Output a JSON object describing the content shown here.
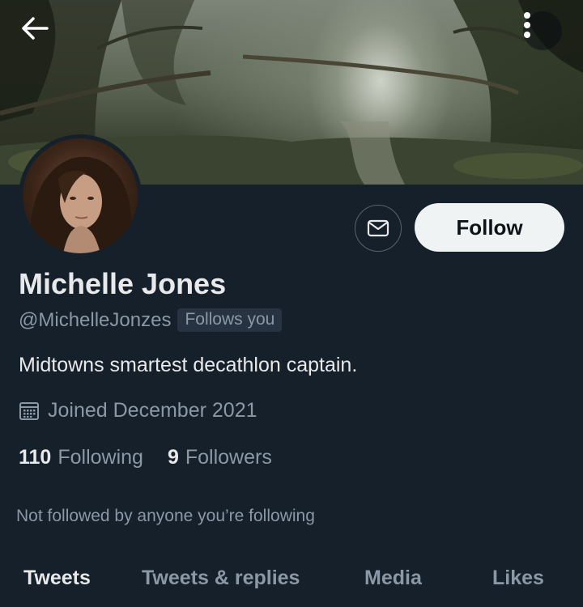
{
  "header": {
    "back_icon": "arrow-left-icon",
    "more_icon": "more-vertical-icon"
  },
  "profile": {
    "name": "Michelle Jones",
    "handle": "@MichelleJonzes",
    "follows_you": "Follows you",
    "bio": "Midtowns smartest decathlon captain.",
    "joined": "Joined December 2021",
    "calendar_icon": "calendar-icon",
    "message_icon": "envelope-icon",
    "follow_label": "Follow",
    "following_count": "110",
    "following_label": "Following",
    "followers_count": "9",
    "followers_label": "Followers",
    "not_followed_text": "Not followed by anyone you’re following"
  },
  "tabs": [
    {
      "label": "Tweets",
      "active": true
    },
    {
      "label": "Tweets & replies",
      "active": false
    },
    {
      "label": "Media",
      "active": false
    },
    {
      "label": "Likes",
      "active": false
    }
  ],
  "colors": {
    "background": "#15202b",
    "primary_text": "#e7e9ea",
    "secondary_text": "#8b98a5",
    "follow_button_bg": "#eff3f4"
  }
}
